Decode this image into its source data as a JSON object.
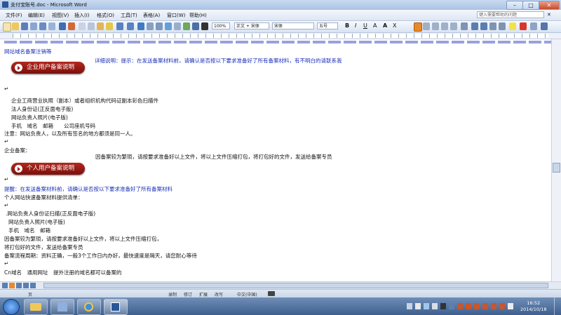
{
  "window": {
    "title": "支付宝账号.doc - Microsoft Word"
  },
  "menubar": {
    "items": [
      "文件(F)",
      "编辑(E)",
      "视图(V)",
      "插入(I)",
      "格式(O)",
      "工具(T)",
      "表格(A)",
      "窗口(W)",
      "帮助(H)"
    ],
    "help_placeholder": "键入需要帮助的问题"
  },
  "toolbar": {
    "style": "正文 + 宋体",
    "font": "宋体",
    "size": "五号",
    "zoom": "100%"
  },
  "document": {
    "top_line": "网站域名备案注销等",
    "banner_enterprise": "企业用户备案说明",
    "enterprise_note": "详细说明：提示：在发送备案材料前，请确认是否按以下要求准备好了所有备案材料，有不明白的请联系我",
    "company_items": [
      "企业工商营业执照（副本）或者组织机构代码证副本彩色扫描件",
      "法人身份证(正反面电子版)",
      "网站负责人照片(电子版)",
      "手机　域名　邮箱　　公司座机号码"
    ],
    "company_note": "注意：网站负责人，以及所有签名的地方都须是同一人。",
    "enterprise_label": "企业备案：",
    "enterprise_text": "因备案较为繁琐，请按要求准备好以上文件，将以上文件压缩打包，将打包好的文件，发送给备案专员",
    "banner_personal": "个人用户备案说明",
    "personal_prompt": "提醒：在发送备案材料前，请确认是否按以下要求准备好了所有备案材料",
    "personal_list_title": "个人网站快速备案材料提供清单：",
    "personal_items": [
      ".网站负责人身份证扫描(正反面电子版)",
      "网站负责人照片(电子版)",
      "手机　域名　邮箱"
    ],
    "personal_steps": [
      "因备案较为繁琐，请按要求准备好以上文件，将以上文件压缩打包，",
      "将打包好的文件，发送给备案专员",
      "备案流程周期：资料正确，一般3个工作日内办好，最快速度是隔天，请您耐心等待"
    ],
    "bottom_line": "Cn域名　通用网址　提外注册的域名都可以备案的"
  },
  "status": {
    "page": "页",
    "items": [
      "录制",
      "修订",
      "扩展",
      "改写"
    ],
    "language": "中文(中国)"
  },
  "taskbar": {
    "time": "16:52",
    "date": "2014/10/18"
  }
}
